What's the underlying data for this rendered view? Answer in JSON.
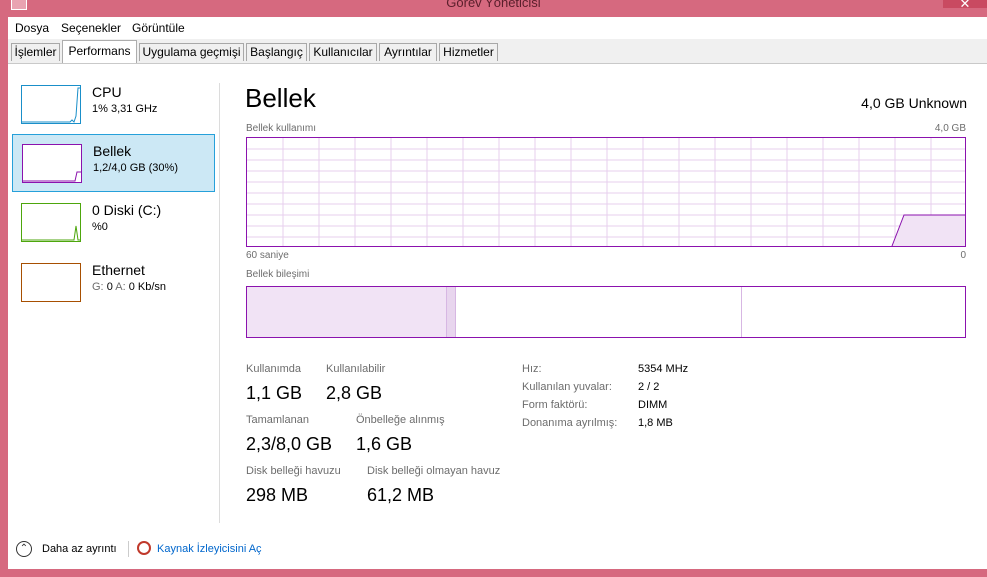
{
  "window": {
    "title": "Görev Yöneticisi",
    "close_glyph": "✕"
  },
  "menu": [
    "Dosya",
    "Seçenekler",
    "Görüntüle"
  ],
  "tabs": [
    "İşlemler",
    "Performans",
    "Uygulama geçmişi",
    "Başlangıç",
    "Kullanıcılar",
    "Ayrıntılar",
    "Hizmetler"
  ],
  "active_tab": "Performans",
  "sidebar": {
    "items": [
      {
        "name": "CPU",
        "sub": "1% 3,31 GHz",
        "color": "#1a8fc9"
      },
      {
        "name": "Bellek",
        "sub": "1,2/4,0 GB (30%)",
        "color": "#8b12ae"
      },
      {
        "name": "0 Diski (C:)",
        "sub": "%0",
        "color": "#4da60c"
      },
      {
        "name": "Ethernet",
        "sub_prefix": "G:",
        "sub_mid": "0",
        "sub_a": "A:",
        "sub_rest": "0 Kb/sn",
        "color": "#a74f01"
      }
    ]
  },
  "main": {
    "title": "Bellek",
    "total": "4,0 GB Unknown",
    "usage_label": "Bellek kullanımı",
    "usage_max": "4,0 GB",
    "time_label": "60 saniye",
    "time_zero": "0",
    "composition_label": "Bellek bileşimi",
    "accent": "#8b12ae"
  },
  "stats": {
    "in_use_label": "Kullanımda",
    "in_use": "1,1 GB",
    "available_label": "Kullanılabilir",
    "available": "2,8 GB",
    "committed_label": "Tamamlanan",
    "committed": "2,3/8,0 GB",
    "cached_label": "Önbelleğe alınmış",
    "cached": "1,6 GB",
    "paged_label": "Disk belleği havuzu",
    "paged": "298 MB",
    "nonpaged_label": "Disk belleği olmayan havuz",
    "nonpaged": "61,2 MB"
  },
  "specs": [
    {
      "label": "Hız:",
      "value": "5354 MHz"
    },
    {
      "label": "Kullanılan yuvalar:",
      "value": "2 / 2"
    },
    {
      "label": "Form faktörü:",
      "value": "DIMM"
    },
    {
      "label": "Donanıma ayrılmış:",
      "value": "1,8 MB"
    }
  ],
  "footer": {
    "fewer_details": "Daha az ayrıntı",
    "open_resmon": "Kaynak İzleyicisini Aç"
  }
}
